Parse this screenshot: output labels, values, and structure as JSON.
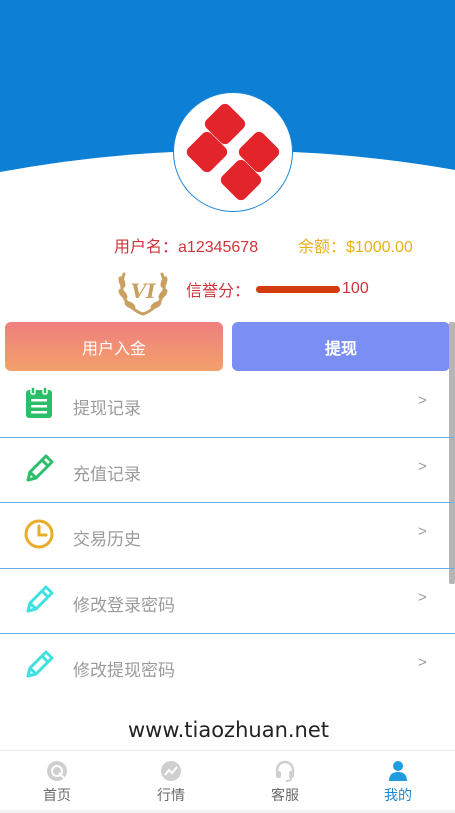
{
  "colors": {
    "header_blue": "#0d7fd4",
    "accent": "#1f86cf",
    "error_red": "#d0343a",
    "gold": "#e8b11a"
  },
  "profile": {
    "avatar_icon": "logo-icon",
    "username_label": "用户名：",
    "username": "a12345678",
    "balance_label": "余额：",
    "balance": "$1000.00",
    "vip_badge_text": "VI",
    "credit_label": "信誉分：",
    "credit_score": "100",
    "credit_progress": 1.0
  },
  "actions": {
    "deposit_label": "用户入金",
    "withdraw_label": "提现"
  },
  "menu": [
    {
      "label": "提现记录",
      "icon": "clipboard-icon",
      "arrow": ">"
    },
    {
      "label": "充值记录",
      "icon": "pencil-icon",
      "arrow": ">"
    },
    {
      "label": "交易历史",
      "icon": "clock-icon",
      "arrow": ">"
    },
    {
      "label": "修改登录密码",
      "icon": "pencil-icon",
      "arrow": ">"
    },
    {
      "label": "修改提现密码",
      "icon": "pencil-icon",
      "arrow": ">"
    }
  ],
  "watermark": "www.tiaozhuan.net",
  "tabbar": [
    {
      "label": "首页",
      "icon": "home-icon",
      "active": false
    },
    {
      "label": "行情",
      "icon": "trend-icon",
      "active": false
    },
    {
      "label": "客服",
      "icon": "headset-icon",
      "active": false
    },
    {
      "label": "我的",
      "icon": "user-icon",
      "active": true
    }
  ]
}
